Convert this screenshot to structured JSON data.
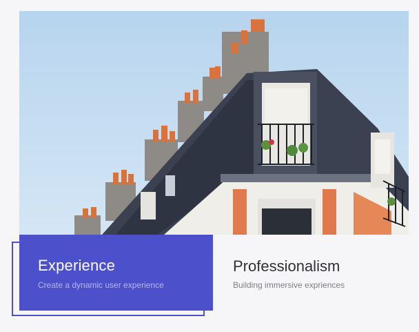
{
  "hero": {
    "alt": "Parisian rooftop with chimneys against a blue sky"
  },
  "features": [
    {
      "title": "Experience",
      "subtitle": "Create a dynamic user experience",
      "accent": "#4c50cb"
    },
    {
      "title": "Professionalism",
      "subtitle": "Building immersive expriences"
    }
  ]
}
